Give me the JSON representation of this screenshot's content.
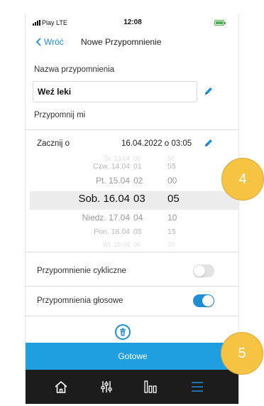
{
  "status_bar": {
    "carrier": "Play  LTE",
    "time": "12:08"
  },
  "nav": {
    "back_label": "Wróć",
    "title": "Nowe Przypomnienie"
  },
  "reminder_name": {
    "label": "Nazwa przypomnienia",
    "value": "Weź leki"
  },
  "remind_me": {
    "label": "Przypomnij mi"
  },
  "start": {
    "label": "Zacznij o",
    "value": "16.04.2022 o 03:05"
  },
  "picker": {
    "rows": [
      {
        "day": "Czw. 14.04",
        "hour": "01",
        "minute": "55"
      },
      {
        "day": "Pt. 15.04",
        "hour": "02",
        "minute": "00"
      },
      {
        "day": "Sob. 16.04",
        "hour": "03",
        "minute": "05"
      },
      {
        "day": "Niedz. 17.04",
        "hour": "04",
        "minute": "10"
      },
      {
        "day": "Pon. 18.04",
        "hour": "05",
        "minute": "15"
      }
    ],
    "selected_index": 2
  },
  "cyclic": {
    "label": "Przypomnienie cykliczne",
    "on": false
  },
  "voice": {
    "label": "Przypomnienia głosowe",
    "on": true
  },
  "done_button": {
    "label": "Gotowe"
  },
  "tabs": [
    {
      "icon": "home-icon"
    },
    {
      "icon": "sliders-icon"
    },
    {
      "icon": "bar-chart-icon"
    },
    {
      "icon": "menu-icon"
    }
  ],
  "badges": [
    "4",
    "5"
  ],
  "colors": {
    "accent": "#1f8fd6",
    "done_bar": "#1f9fe0",
    "tabbar": "#1c1c1c",
    "badge": "#f6c342"
  }
}
